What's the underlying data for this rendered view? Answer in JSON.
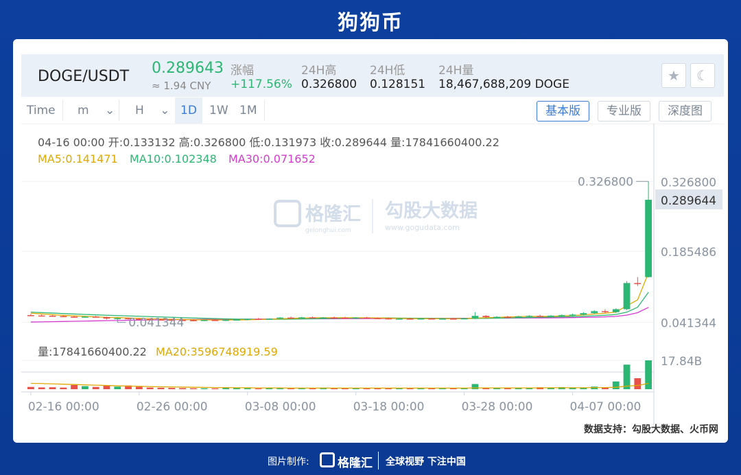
{
  "page": {
    "title": "狗狗币"
  },
  "ticker": {
    "pair": "DOGE/USDT",
    "price": "0.289643",
    "cny": "≈ 1.94 CNY",
    "stats": [
      {
        "label": "涨幅",
        "value": "+117.56%",
        "up": true
      },
      {
        "label": "24H高",
        "value": "0.326800",
        "up": false
      },
      {
        "label": "24H低",
        "value": "0.128151",
        "up": false
      },
      {
        "label": "24H量",
        "value": "18,467,688,209 DOGE",
        "up": false
      }
    ]
  },
  "toolbar": {
    "items": [
      "Time",
      "m",
      "H",
      "1D",
      "1W",
      "1M"
    ],
    "active": "1D",
    "views": [
      "基本版",
      "专业版",
      "深度图"
    ],
    "active_view": "基本版"
  },
  "chart_data": {
    "type": "candlestick",
    "info_line": "04-16 00:00  开:0.133132  高:0.326800  低:0.131973  收:0.289644  量:17841660400.22",
    "ma_labels": [
      {
        "text": "MA5:0.141471",
        "color": "#e0a800"
      },
      {
        "text": "MA10:0.102348",
        "color": "#2bb673"
      },
      {
        "text": "MA30:0.071652",
        "color": "#d63ad1"
      }
    ],
    "y_ticks": [
      "0.326800",
      "0.185486",
      "0.041344"
    ],
    "y_tick_values": [
      0.3268,
      0.185486,
      0.041344
    ],
    "ylim": [
      0.02,
      0.355
    ],
    "last_price_label": "0.289644",
    "last_price": 0.289644,
    "max_marker": {
      "text": "0.326800",
      "value": 0.3268
    },
    "min_marker": {
      "text": "0.041344",
      "value": 0.041344
    },
    "x_ticks": [
      "02-16 00:00",
      "02-26 00:00",
      "03-08 00:00",
      "03-18 00:00",
      "03-28 00:00",
      "04-07 00:00"
    ],
    "x_tick_index": [
      0,
      10,
      20,
      30,
      40,
      50
    ],
    "volume_label": "量:17841660400.22",
    "volume_ma_label": "MA20:3596748919.59",
    "volume_tick": "17.84B",
    "volume_max": 17.84,
    "candles": [
      [
        0.056,
        0.0585,
        0.054,
        0.0552
      ],
      [
        0.0552,
        0.057,
        0.0535,
        0.0548
      ],
      [
        0.0548,
        0.056,
        0.053,
        0.054
      ],
      [
        0.054,
        0.0555,
        0.052,
        0.0528
      ],
      [
        0.0528,
        0.0545,
        0.0515,
        0.0525
      ],
      [
        0.0525,
        0.054,
        0.051,
        0.053
      ],
      [
        0.053,
        0.0545,
        0.0515,
        0.052
      ],
      [
        0.052,
        0.053,
        0.047,
        0.049
      ],
      [
        0.049,
        0.052,
        0.0413,
        0.05
      ],
      [
        0.05,
        0.051,
        0.047,
        0.0485
      ],
      [
        0.0485,
        0.05,
        0.0465,
        0.0478
      ],
      [
        0.0478,
        0.0495,
        0.046,
        0.047
      ],
      [
        0.047,
        0.049,
        0.0455,
        0.0468
      ],
      [
        0.0468,
        0.0485,
        0.045,
        0.0462
      ],
      [
        0.0462,
        0.048,
        0.0445,
        0.0458
      ],
      [
        0.0458,
        0.0475,
        0.044,
        0.0455
      ],
      [
        0.0455,
        0.047,
        0.044,
        0.0462
      ],
      [
        0.0462,
        0.0478,
        0.0445,
        0.045
      ],
      [
        0.045,
        0.047,
        0.044,
        0.0465
      ],
      [
        0.0465,
        0.048,
        0.045,
        0.047
      ],
      [
        0.047,
        0.049,
        0.0455,
        0.0485
      ],
      [
        0.0485,
        0.05,
        0.0465,
        0.0478
      ],
      [
        0.0478,
        0.0495,
        0.0465,
        0.0488
      ],
      [
        0.0488,
        0.052,
        0.0475,
        0.051
      ],
      [
        0.051,
        0.053,
        0.0495,
        0.0505
      ],
      [
        0.0505,
        0.0525,
        0.049,
        0.0515
      ],
      [
        0.0515,
        0.053,
        0.0495,
        0.05
      ],
      [
        0.05,
        0.052,
        0.0485,
        0.0512
      ],
      [
        0.0512,
        0.053,
        0.0495,
        0.0508
      ],
      [
        0.0508,
        0.0525,
        0.049,
        0.0502
      ],
      [
        0.0502,
        0.052,
        0.0485,
        0.051
      ],
      [
        0.051,
        0.0525,
        0.0495,
        0.05
      ],
      [
        0.05,
        0.0515,
        0.048,
        0.0495
      ],
      [
        0.0495,
        0.051,
        0.047,
        0.048
      ],
      [
        0.048,
        0.05,
        0.047,
        0.049
      ],
      [
        0.049,
        0.0505,
        0.0475,
        0.0485
      ],
      [
        0.0485,
        0.05,
        0.047,
        0.0492
      ],
      [
        0.0492,
        0.0505,
        0.048,
        0.0488
      ],
      [
        0.0488,
        0.05,
        0.0475,
        0.049
      ],
      [
        0.049,
        0.0505,
        0.0478,
        0.0486
      ],
      [
        0.0486,
        0.05,
        0.0475,
        0.0495
      ],
      [
        0.0495,
        0.062,
        0.048,
        0.0545
      ],
      [
        0.0545,
        0.056,
        0.05,
        0.052
      ],
      [
        0.052,
        0.054,
        0.0505,
        0.0525
      ],
      [
        0.0525,
        0.0545,
        0.051,
        0.052
      ],
      [
        0.052,
        0.0545,
        0.051,
        0.0535
      ],
      [
        0.0535,
        0.056,
        0.0515,
        0.0545
      ],
      [
        0.0545,
        0.057,
        0.0525,
        0.0535
      ],
      [
        0.0535,
        0.056,
        0.052,
        0.055
      ],
      [
        0.055,
        0.0575,
        0.053,
        0.056
      ],
      [
        0.056,
        0.059,
        0.054,
        0.057
      ],
      [
        0.057,
        0.062,
        0.0555,
        0.06
      ],
      [
        0.06,
        0.066,
        0.058,
        0.064
      ],
      [
        0.064,
        0.068,
        0.06,
        0.062
      ],
      [
        0.062,
        0.07,
        0.06,
        0.068
      ],
      [
        0.068,
        0.125,
        0.066,
        0.121
      ],
      [
        0.121,
        0.133,
        0.115,
        0.12
      ],
      [
        0.1331,
        0.3268,
        0.132,
        0.2896
      ]
    ],
    "ma5": [
      0.06,
      0.0585,
      0.057,
      0.0555,
      0.0545,
      0.0535,
      0.0525,
      0.0515,
      0.051,
      0.0502,
      0.0495,
      0.0488,
      0.0482,
      0.0476,
      0.0472,
      0.0468,
      0.0465,
      0.0463,
      0.0462,
      0.0463,
      0.0467,
      0.0472,
      0.0478,
      0.0486,
      0.0493,
      0.05,
      0.0506,
      0.0508,
      0.0508,
      0.0508,
      0.0507,
      0.0506,
      0.0503,
      0.0498,
      0.0493,
      0.049,
      0.0488,
      0.0488,
      0.0488,
      0.0488,
      0.0489,
      0.05,
      0.0508,
      0.0515,
      0.0522,
      0.0529,
      0.0535,
      0.0533,
      0.0537,
      0.0544,
      0.0553,
      0.0565,
      0.0584,
      0.0598,
      0.0622,
      0.075,
      0.087,
      0.1415
    ],
    "ma10": [
      0.062,
      0.0612,
      0.0602,
      0.0592,
      0.0583,
      0.0574,
      0.0566,
      0.0558,
      0.0551,
      0.0544,
      0.0537,
      0.053,
      0.0523,
      0.0516,
      0.0509,
      0.0502,
      0.0496,
      0.049,
      0.0485,
      0.048,
      0.0478,
      0.0476,
      0.0476,
      0.0477,
      0.0479,
      0.0483,
      0.0487,
      0.0491,
      0.0495,
      0.0499,
      0.0502,
      0.0504,
      0.0504,
      0.0503,
      0.0501,
      0.0499,
      0.0497,
      0.0495,
      0.0493,
      0.0491,
      0.0491,
      0.0493,
      0.0496,
      0.05,
      0.0504,
      0.0508,
      0.0512,
      0.0516,
      0.052,
      0.0525,
      0.053,
      0.0537,
      0.0547,
      0.0557,
      0.0573,
      0.062,
      0.072,
      0.1023
    ],
    "ma30": [
      0.042,
      0.0424,
      0.0428,
      0.0432,
      0.0436,
      0.044,
      0.0444,
      0.0448,
      0.0452,
      0.0456,
      0.0459,
      0.0462,
      0.0465,
      0.0468,
      0.047,
      0.0472,
      0.0474,
      0.0476,
      0.0477,
      0.0478,
      0.0479,
      0.048,
      0.0481,
      0.0482,
      0.0483,
      0.0484,
      0.0485,
      0.0486,
      0.0487,
      0.0488,
      0.0489,
      0.049,
      0.0491,
      0.0492,
      0.0493,
      0.0493,
      0.0494,
      0.0494,
      0.0495,
      0.0495,
      0.0496,
      0.0497,
      0.0498,
      0.0499,
      0.05,
      0.0501,
      0.0502,
      0.0503,
      0.0505,
      0.0507,
      0.051,
      0.0514,
      0.0519,
      0.0525,
      0.0535,
      0.056,
      0.061,
      0.0717
    ],
    "volume": [
      1.4,
      1.1,
      1.2,
      1.0,
      2.6,
      1.9,
      1.4,
      2.1,
      1.6,
      2.3,
      1.5,
      1.0,
      0.9,
      0.8,
      0.7,
      0.6,
      0.6,
      0.5,
      0.8,
      0.9,
      0.6,
      0.5,
      0.8,
      0.6,
      0.5,
      0.9,
      0.6,
      1.0,
      0.8,
      0.7,
      0.6,
      0.6,
      0.5,
      0.8,
      0.6,
      0.7,
      0.5,
      0.6,
      0.6,
      0.6,
      0.6,
      3.2,
      0.8,
      0.8,
      0.8,
      0.7,
      0.8,
      1.2,
      0.9,
      1.3,
      1.1,
      1.0,
      1.6,
      1.1,
      4.8,
      15.2,
      6.8,
      17.84
    ],
    "volume_ma": [
      3.6,
      3.5,
      3.3,
      3.1,
      2.9,
      2.7,
      2.5,
      2.3,
      2.1,
      1.9,
      1.8,
      1.6,
      1.5,
      1.4,
      1.3,
      1.2,
      1.1,
      1.0,
      1.0,
      0.9,
      0.9,
      0.8,
      0.8,
      0.8,
      0.7,
      0.7,
      0.7,
      0.7,
      0.7,
      0.7,
      0.7,
      0.7,
      0.7,
      0.7,
      0.7,
      0.7,
      0.7,
      0.7,
      0.7,
      0.7,
      0.7,
      0.8,
      0.8,
      0.8,
      0.8,
      0.8,
      0.8,
      0.8,
      0.9,
      0.9,
      0.9,
      0.9,
      1.0,
      1.0,
      1.2,
      1.9,
      2.3,
      3.6
    ]
  },
  "watermark": {
    "brand": "格隆汇",
    "brand_sub": "gelonghui.com",
    "partner": "勾股大数据",
    "partner_sub": "www.gogudata.com"
  },
  "footer": {
    "note": "数据支持：勾股大数据、火币网"
  },
  "credit": {
    "label": "图片制作:",
    "brand": "格隆汇",
    "slogan": "全球视野 下注中国"
  },
  "colors": {
    "up": "#2bb673",
    "down": "#e8504a",
    "accent": "#3a7bd5"
  }
}
